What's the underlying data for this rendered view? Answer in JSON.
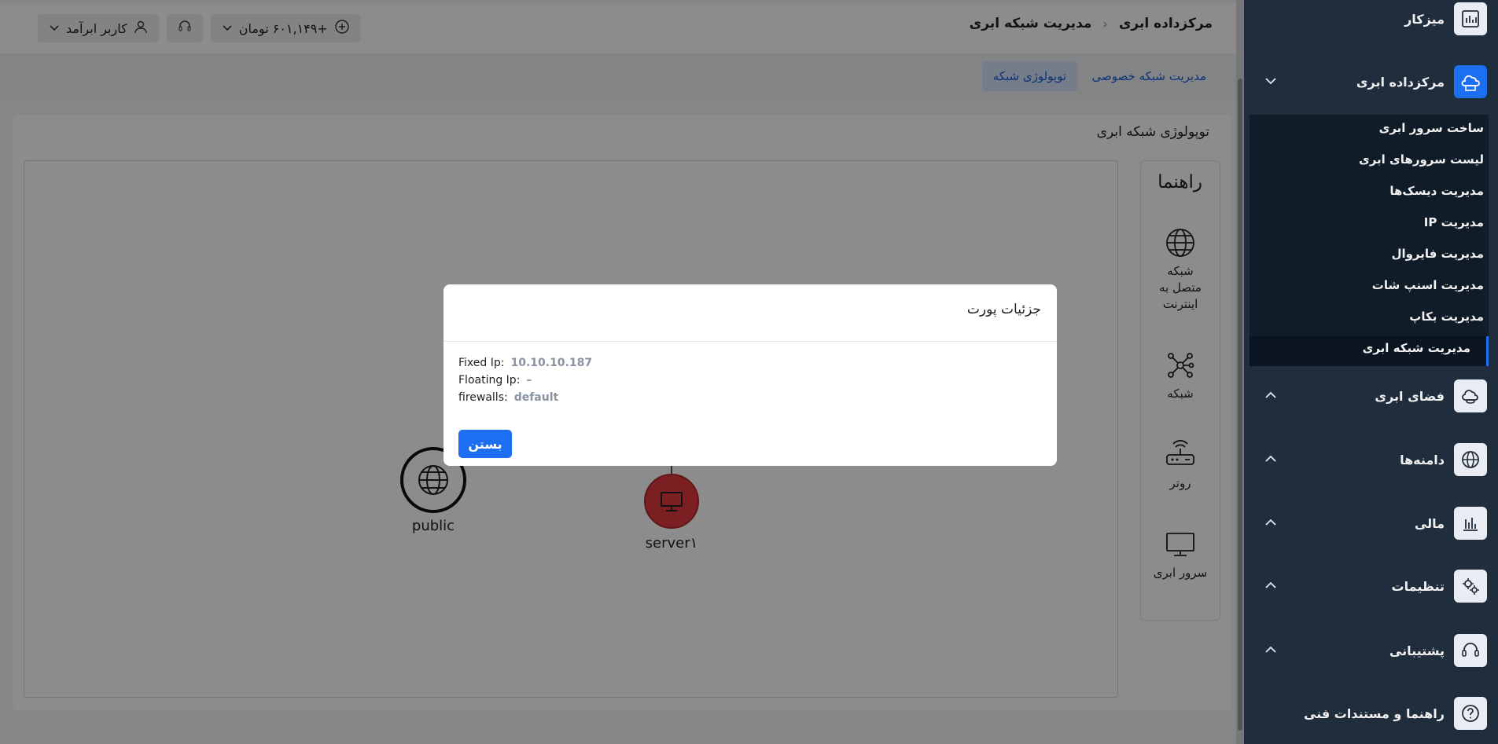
{
  "header": {
    "breadcrumb": [
      "مرکزداده ابری",
      "مدیریت شبکه ابری"
    ],
    "balance": "+۶۰۱,۱۴۹ تومان",
    "user": "کاربر ابرآمد"
  },
  "tabs": [
    {
      "label": "مدیریت شبکه خصوصی",
      "active": false
    },
    {
      "label": "توپولوژی شبکه",
      "active": true
    }
  ],
  "panel": {
    "title": "توپولوژی شبکه ابری"
  },
  "legend": {
    "title": "راهنما",
    "items": [
      {
        "label": "شبکه متصل به اینترنت",
        "icon": "globe-icon"
      },
      {
        "label": "شبکه",
        "icon": "network-icon"
      },
      {
        "label": "روتر",
        "icon": "router-icon"
      },
      {
        "label": "سرور ابری",
        "icon": "monitor-icon"
      }
    ]
  },
  "nodes": [
    {
      "label": "public",
      "icon": "globe-icon"
    },
    {
      "label": "server۱",
      "icon": "monitor-icon",
      "color": "#e0393e"
    }
  ],
  "sidebar": {
    "items": [
      {
        "label": "میزکار",
        "icon": "dashboard-icon"
      },
      {
        "label": "مرکزداده ابری",
        "icon": "cloud-datacenter-icon",
        "active": true
      },
      {
        "label": "فضای ابری",
        "icon": "cloud-storage-icon"
      },
      {
        "label": "دامنه‌ها",
        "icon": "globe-icon"
      },
      {
        "label": "مالی",
        "icon": "chart-icon"
      },
      {
        "label": "تنظیمات",
        "icon": "gears-icon"
      },
      {
        "label": "پشتیبانی",
        "icon": "headset-icon"
      },
      {
        "label": "راهنما و مستندات فنی",
        "icon": "help-icon"
      }
    ],
    "submenu": [
      "ساخت سرور ابری",
      "لیست سرورهای ابری",
      "مدیریت دیسک‌ها",
      "مدیریت IP",
      "مدیریت فایروال",
      "مدیریت اسنپ شات",
      "مدیریت بکاپ",
      "مدیریت شبکه ابری"
    ]
  },
  "modal": {
    "title": "جزئیات پورت",
    "fields": [
      {
        "key": "Fixed Ip:",
        "value": "10.10.10.187"
      },
      {
        "key": "Floating Ip:",
        "value": "–"
      },
      {
        "key": "firewalls:",
        "value": "default"
      }
    ],
    "close_label": "بستن"
  },
  "colors": {
    "accent": "#1d6ff2",
    "sidebar": "#1f2d3d",
    "server_node": "#e0393e"
  }
}
